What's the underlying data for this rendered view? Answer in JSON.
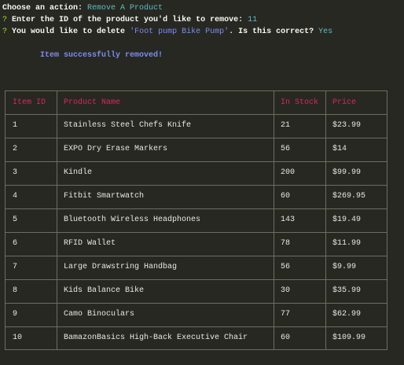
{
  "prompt1": {
    "label": "Choose an action:",
    "answer": "Remove A Product"
  },
  "prompt2": {
    "mark": "?",
    "label": "Enter the ID of the product you'd like to remove:",
    "answer": "11"
  },
  "prompt3": {
    "mark": "?",
    "label_before": "You would like to delete",
    "product": "'Foot pump Bike Pump'",
    "label_after": ". Is this correct?",
    "answer": "Yes"
  },
  "message": "Item successfully removed!",
  "table": {
    "headers": [
      "Item ID",
      "Product Name",
      "In Stock",
      "Price"
    ],
    "rows": [
      [
        "1",
        "Stainless Steel Chefs Knife",
        "21",
        "$23.99"
      ],
      [
        "2",
        "EXPO Dry Erase Markers",
        "56",
        "$14"
      ],
      [
        "3",
        "Kindle",
        "200",
        "$99.99"
      ],
      [
        "4",
        "Fitbit Smartwatch",
        "60",
        "$269.95"
      ],
      [
        "5",
        "Bluetooth Wireless Headphones",
        "143",
        "$19.49"
      ],
      [
        "6",
        "RFID Wallet",
        "78",
        "$11.99"
      ],
      [
        "7",
        "Large Drawstring Handbag",
        "56",
        "$9.99"
      ],
      [
        "8",
        "Kids Balance Bike",
        "30",
        "$35.99"
      ],
      [
        "9",
        "Camo Binoculars",
        "77",
        "$62.99"
      ],
      [
        "10",
        "BamazonBasics High-Back Executive Chair",
        "60",
        "$109.99"
      ]
    ]
  },
  "colors": {
    "background": "#272822",
    "header": "#e0245e",
    "answer": "#5fbcc4",
    "accent": "#7d8cf0",
    "prompt_mark": "#a6e22e"
  }
}
